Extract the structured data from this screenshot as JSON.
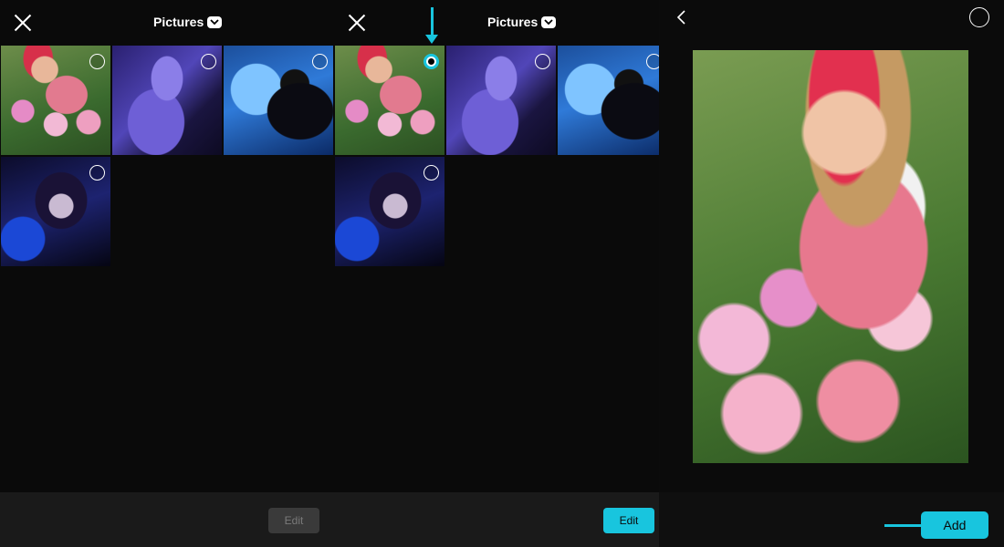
{
  "panel1": {
    "title": "Pictures",
    "edit_label": "Edit",
    "thumbs": [
      {
        "icon": "girl-roses-photo"
      },
      {
        "icon": "purple-anime-photo"
      },
      {
        "icon": "blue-anime-photo"
      },
      {
        "icon": "dark-anime-photo"
      }
    ]
  },
  "panel2": {
    "title": "Pictures",
    "edit_label": "Edit"
  },
  "panel3": {
    "add_label": "Add"
  },
  "colors": {
    "accent": "#18c5de",
    "background": "#0a0a0a",
    "bottom_bar": "#1a1a1a",
    "disabled": "#3a3a3a"
  }
}
